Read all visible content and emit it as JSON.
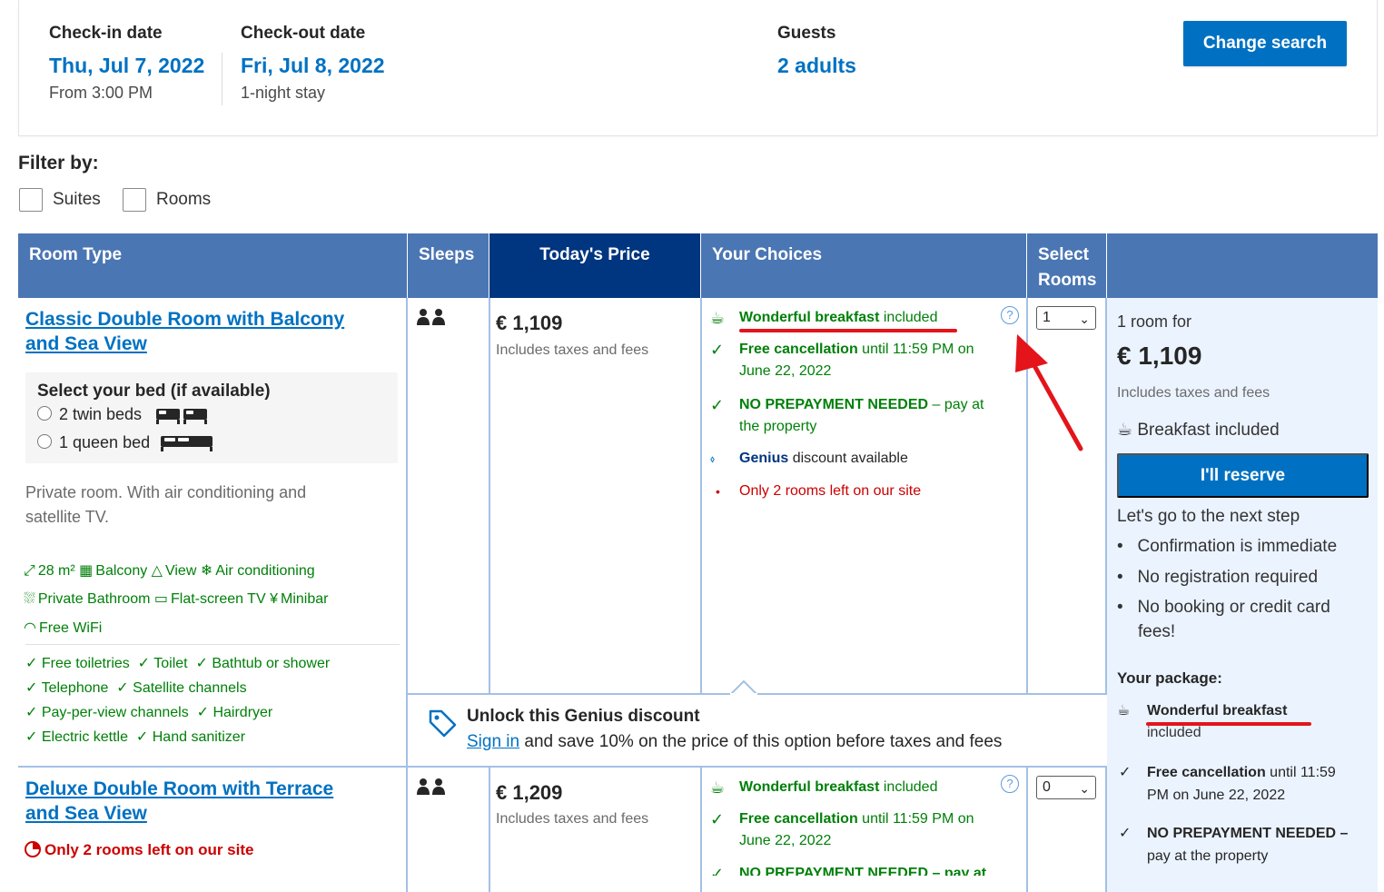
{
  "search": {
    "checkin_label": "Check-in date",
    "checkin_value": "Thu, Jul 7, 2022",
    "checkin_sub": "From 3:00 PM",
    "checkout_label": "Check-out date",
    "checkout_value": "Fri, Jul 8, 2022",
    "checkout_sub": "1-night stay",
    "guests_label": "Guests",
    "guests_value": "2 adults",
    "change_button": "Change search"
  },
  "filter": {
    "title": "Filter by:",
    "options": [
      "Suites",
      "Rooms"
    ]
  },
  "table": {
    "headers": {
      "room_type": "Room Type",
      "sleeps": "Sleeps",
      "price": "Today's Price",
      "choices": "Your Choices",
      "select_rooms_1": "Select",
      "select_rooms_2": "Rooms"
    }
  },
  "room1": {
    "name_line1": "Classic Double Room with Balcony",
    "name_line2": "and Sea View",
    "bed_title": "Select your bed (if available)",
    "bed_option1": "2 twin beds",
    "bed_option2": "1 queen bed",
    "desc_line1": "Private room. With air conditioning and",
    "desc_line2": "satellite TV.",
    "amenities_row1": [
      "28 m²",
      "Balcony",
      "View",
      "Air conditioning"
    ],
    "amenities_row2": [
      "Private Bathroom",
      "Flat-screen TV",
      "Minibar"
    ],
    "amenities_row3": [
      "Free WiFi"
    ],
    "facilities": [
      [
        "Free toiletries",
        "Toilet",
        "Bathtub or shower"
      ],
      [
        "Telephone",
        "Satellite channels"
      ],
      [
        "Pay-per-view channels",
        "Hairdryer"
      ],
      [
        "Electric kettle",
        "Hand sanitizer"
      ]
    ],
    "price": "€ 1,109",
    "price_note": "Includes taxes and fees",
    "choice_breakfast_bold": "Wonderful breakfast",
    "choice_breakfast_rest": "included",
    "choice_cancel_bold": "Free cancellation",
    "choice_cancel_rest1": "until 11:59 PM on",
    "choice_cancel_rest2": "June 22, 2022",
    "choice_prepay_bold": "NO PREPAYMENT NEEDED",
    "choice_prepay_rest1": "– pay at",
    "choice_prepay_rest2": "the property",
    "choice_genius_bold": "Genius",
    "choice_genius_rest": "discount available",
    "choice_left": "Only 2 rooms left on our site",
    "select_value": "1"
  },
  "genius_unlock": {
    "title": "Unlock this Genius discount",
    "link": "Sign in",
    "rest": "and save 10% on the price of this option before taxes and fees"
  },
  "room2": {
    "name_line1": "Deluxe Double Room with Terrace",
    "name_line2": "and Sea View",
    "left_badge": "Only 2 rooms left on our site",
    "price": "€ 1,209",
    "price_note": "Includes taxes and fees",
    "choice_breakfast_bold": "Wonderful breakfast",
    "choice_breakfast_rest": "included",
    "choice_cancel_bold": "Free cancellation",
    "choice_cancel_rest1": "until 11:59 PM on",
    "choice_cancel_rest2": "June 22, 2022",
    "choice_prepay_partial": "NO PREPAYMENT NEEDED – pay at",
    "select_value": "0"
  },
  "reserve": {
    "rooms_for": "1 room for",
    "total": "€ 1,109",
    "taxes": "Includes taxes and fees",
    "breakfast": "Breakfast included",
    "button": "I'll reserve",
    "next_step": "Let's go to the next step",
    "bullets": [
      "Confirmation is immediate",
      "No registration required",
      "No booking or credit card",
      "fees!"
    ],
    "package_title": "Your package:",
    "pkg_breakfast_bold": "Wonderful breakfast",
    "pkg_breakfast_rest": "included",
    "pkg_cancel_bold": "Free cancellation",
    "pkg_cancel_rest1": "until 11:59",
    "pkg_cancel_rest2": "PM on June 22, 2022",
    "pkg_prepay_bold": "NO PREPAYMENT NEEDED –",
    "pkg_prepay_rest": "pay at the property"
  },
  "colors": {
    "brand_blue": "#0071c2",
    "header_blue": "#4b76b4",
    "dark_blue": "#003580",
    "green": "#008009",
    "annotation_red": "#e4141b"
  }
}
